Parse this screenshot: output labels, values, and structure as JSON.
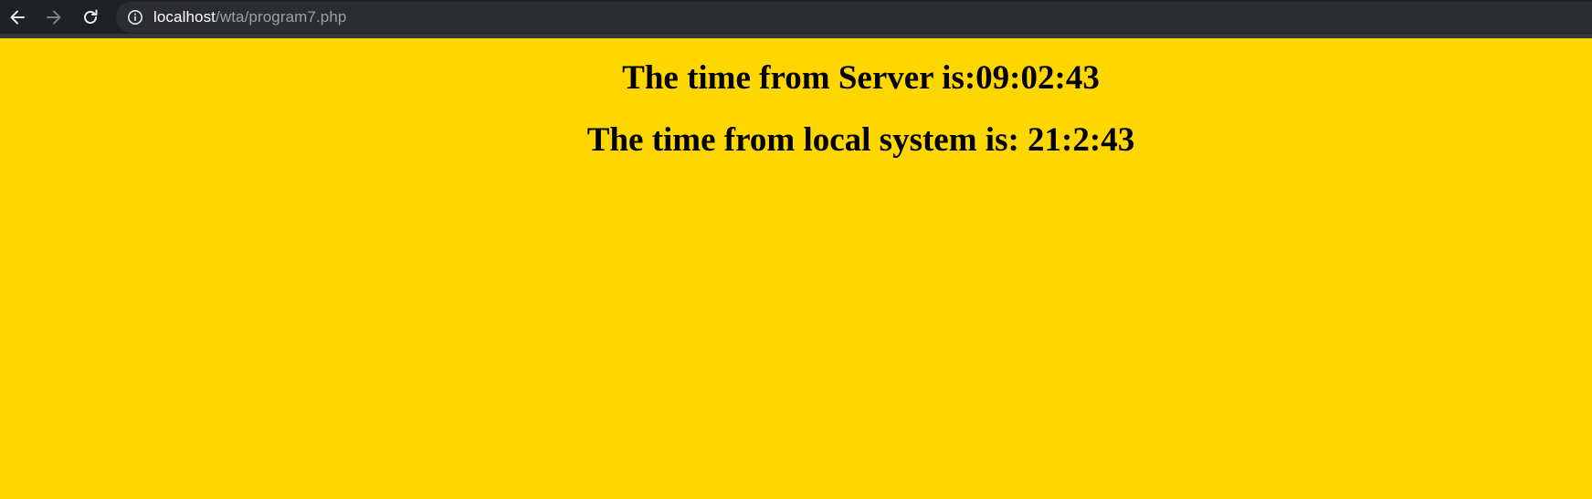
{
  "browser": {
    "url_host": "localhost",
    "url_path": "/wta/program7.php",
    "icons": {
      "back": "arrow-left-icon",
      "forward": "arrow-right-icon",
      "reload": "reload-icon",
      "site_info": "info-icon"
    }
  },
  "page": {
    "background_color": "#ffd700",
    "server_time_text": "The time from Server is:09:02:43",
    "local_time_text": "The time from local system is: 21:2:43"
  }
}
